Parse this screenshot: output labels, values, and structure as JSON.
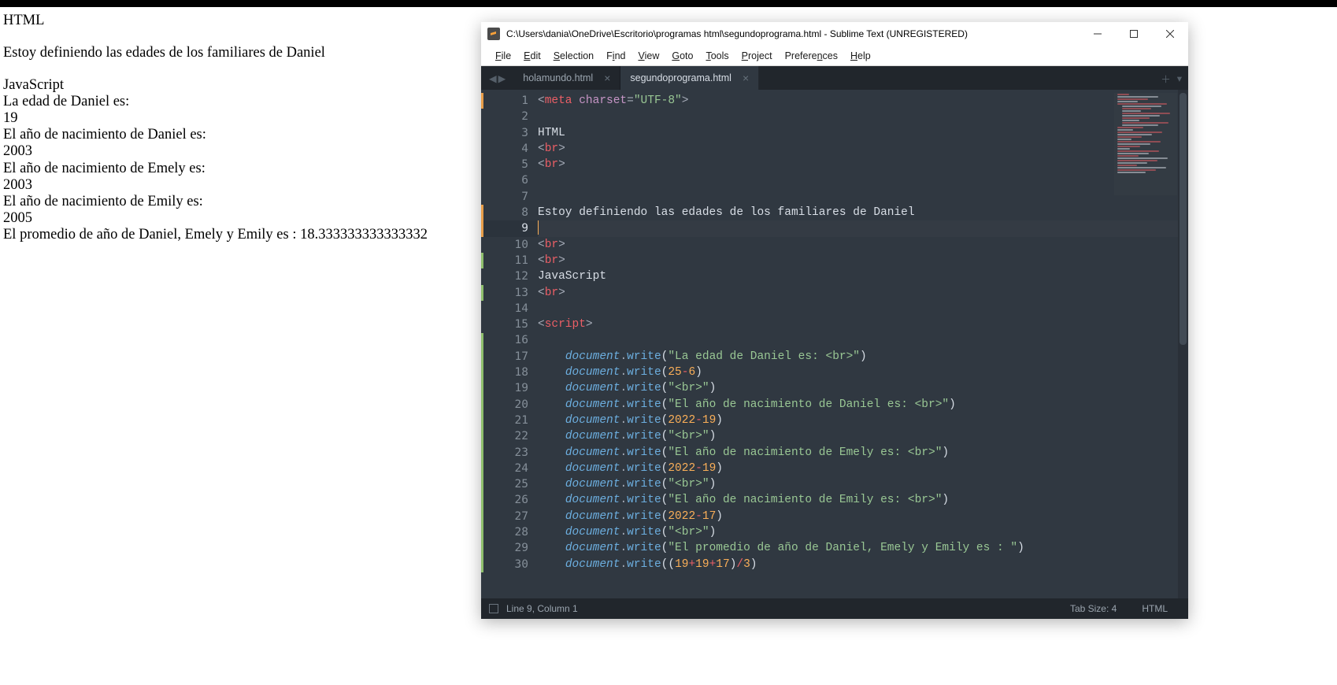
{
  "browser": {
    "title": "HTML",
    "subtitle": "Estoy definiendo las edades de los familiares de Daniel",
    "script_label": "JavaScript",
    "lines": [
      "La edad de Daniel es:",
      "19",
      "El año de nacimiento de Daniel es:",
      "2003",
      "El año de nacimiento de Emely es:",
      "2003",
      "El año de nacimiento de Emily es:",
      "2005",
      "El promedio de año de Daniel, Emely y Emily es : 18.333333333333332"
    ]
  },
  "sublime": {
    "title": "C:\\Users\\dania\\OneDrive\\Escritorio\\programas html\\segundoprograma.html - Sublime Text (UNREGISTERED)",
    "menu": [
      "File",
      "Edit",
      "Selection",
      "Find",
      "View",
      "Goto",
      "Tools",
      "Project",
      "Preferences",
      "Help"
    ],
    "tabs": [
      {
        "label": "holamundo.html",
        "active": false
      },
      {
        "label": "segundoprograma.html",
        "active": true
      }
    ],
    "statusbar": {
      "position": "Line 9, Column 1",
      "tab_size": "Tab Size: 4",
      "syntax": "HTML"
    },
    "code": {
      "line_count": 30,
      "current_line": 9,
      "mod_markers": [
        {
          "from": 1,
          "to": 1,
          "color": "orange"
        },
        {
          "from": 8,
          "to": 9,
          "color": "orange"
        },
        {
          "from": 11,
          "to": 11,
          "color": "green"
        },
        {
          "from": 13,
          "to": 13,
          "color": "green"
        },
        {
          "from": 16,
          "to": 30,
          "color": "green"
        }
      ],
      "rows": [
        {
          "kind": "raw",
          "tokens": [
            {
              "t": "<",
              "c": "punc"
            },
            {
              "t": "meta",
              "c": "tag"
            },
            {
              "t": " ",
              "c": "plain"
            },
            {
              "t": "charset",
              "c": "attr"
            },
            {
              "t": "=",
              "c": "punc"
            },
            {
              "t": "\"UTF-8\"",
              "c": "str"
            },
            {
              "t": ">",
              "c": "punc"
            }
          ]
        },
        {
          "kind": "blank"
        },
        {
          "kind": "plain",
          "text": "HTML"
        },
        {
          "kind": "br"
        },
        {
          "kind": "br"
        },
        {
          "kind": "blank"
        },
        {
          "kind": "blank"
        },
        {
          "kind": "plain",
          "text": "Estoy definiendo las edades de los familiares de Daniel"
        },
        {
          "kind": "cursor"
        },
        {
          "kind": "br"
        },
        {
          "kind": "br"
        },
        {
          "kind": "plain",
          "text": "JavaScript"
        },
        {
          "kind": "br"
        },
        {
          "kind": "blank"
        },
        {
          "kind": "opentag",
          "name": "script"
        },
        {
          "kind": "blank"
        },
        {
          "kind": "docwrite_str",
          "indent": "    ",
          "str": "\"La edad de Daniel es: <br>\""
        },
        {
          "kind": "docwrite_expr",
          "indent": "    ",
          "expr": [
            {
              "t": "25",
              "c": "num"
            },
            {
              "t": "-",
              "c": "tag"
            },
            {
              "t": "6",
              "c": "num"
            }
          ]
        },
        {
          "kind": "docwrite_str",
          "indent": "    ",
          "str": "\"<br>\""
        },
        {
          "kind": "docwrite_str",
          "indent": "    ",
          "str": "\"El año de nacimiento de Daniel es: <br>\""
        },
        {
          "kind": "docwrite_expr",
          "indent": "    ",
          "expr": [
            {
              "t": "2022",
              "c": "num"
            },
            {
              "t": "-",
              "c": "tag"
            },
            {
              "t": "19",
              "c": "num"
            }
          ]
        },
        {
          "kind": "docwrite_str",
          "indent": "    ",
          "str": "\"<br>\""
        },
        {
          "kind": "docwrite_str",
          "indent": "    ",
          "str": "\"El año de nacimiento de Emely es: <br>\""
        },
        {
          "kind": "docwrite_expr",
          "indent": "    ",
          "expr": [
            {
              "t": "2022",
              "c": "num"
            },
            {
              "t": "-",
              "c": "tag"
            },
            {
              "t": "19",
              "c": "num"
            }
          ]
        },
        {
          "kind": "docwrite_str",
          "indent": "    ",
          "str": "\"<br>\""
        },
        {
          "kind": "docwrite_str",
          "indent": "    ",
          "str": "\"El año de nacimiento de Emily es: <br>\""
        },
        {
          "kind": "docwrite_expr",
          "indent": "    ",
          "expr": [
            {
              "t": "2022",
              "c": "num"
            },
            {
              "t": "-",
              "c": "tag"
            },
            {
              "t": "17",
              "c": "num"
            }
          ]
        },
        {
          "kind": "docwrite_str",
          "indent": "    ",
          "str": "\"<br>\""
        },
        {
          "kind": "docwrite_str",
          "indent": "    ",
          "str": "\"El promedio de año de Daniel, Emely y Emily es : \""
        },
        {
          "kind": "docwrite_expr",
          "indent": "    ",
          "expr": [
            {
              "t": "(",
              "c": "bracket"
            },
            {
              "t": "19",
              "c": "num"
            },
            {
              "t": "+",
              "c": "tag"
            },
            {
              "t": "19",
              "c": "num"
            },
            {
              "t": "+",
              "c": "tag"
            },
            {
              "t": "17",
              "c": "num"
            },
            {
              "t": ")",
              "c": "bracket"
            },
            {
              "t": "/",
              "c": "tag"
            },
            {
              "t": "3",
              "c": "num"
            }
          ]
        }
      ]
    }
  }
}
